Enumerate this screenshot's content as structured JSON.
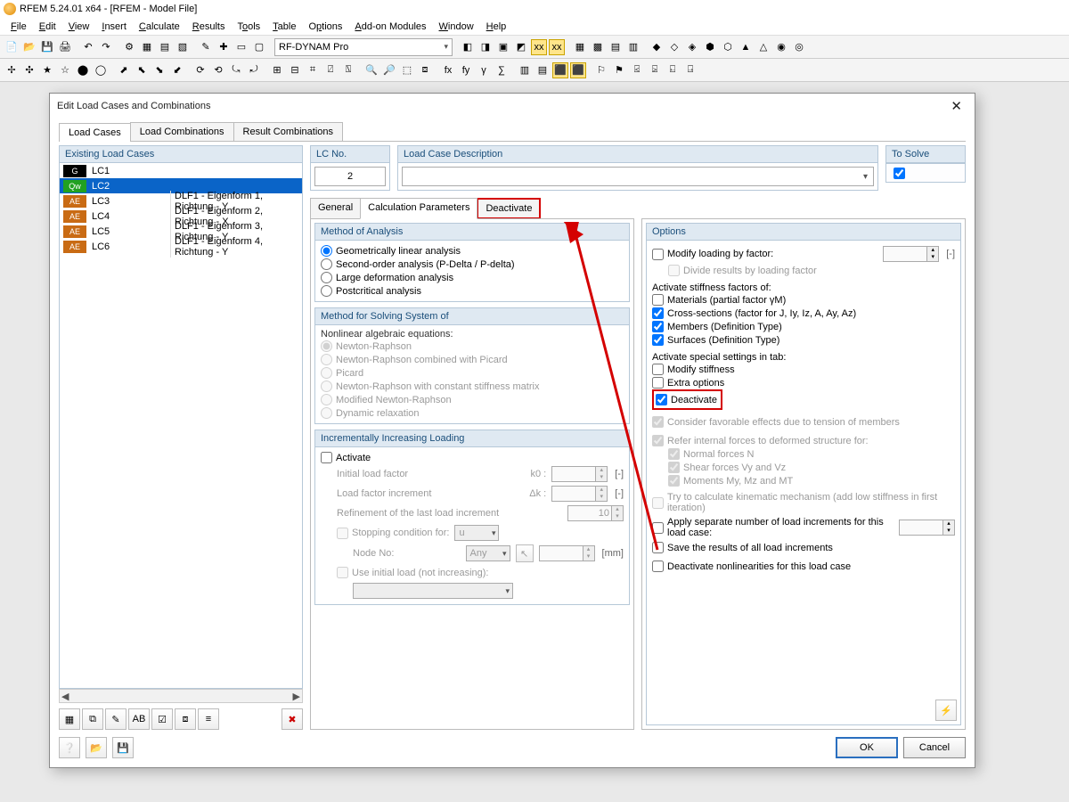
{
  "window": {
    "title": "RFEM 5.24.01 x64 - [RFEM - Model File]"
  },
  "menu": [
    "File",
    "Edit",
    "View",
    "Insert",
    "Calculate",
    "Results",
    "Tools",
    "Table",
    "Options",
    "Add-on Modules",
    "Window",
    "Help"
  ],
  "combo_addon": "RF-DYNAM Pro",
  "dialog": {
    "title": "Edit Load Cases and Combinations",
    "tabs": [
      "Load Cases",
      "Load Combinations",
      "Result Combinations"
    ],
    "activeTab": 0,
    "left": {
      "head": "Existing Load Cases",
      "items": [
        {
          "tag": "G",
          "cls": "g",
          "id": "LC1",
          "desc": ""
        },
        {
          "tag": "Qw",
          "cls": "qw",
          "id": "LC2",
          "desc": "",
          "sel": true
        },
        {
          "tag": "AE",
          "cls": "ae",
          "id": "LC3",
          "desc": "DLF1 - Eigenform 1, Richtung - Y"
        },
        {
          "tag": "AE",
          "cls": "ae",
          "id": "LC4",
          "desc": "DLF1 - Eigenform 2, Richtung - X"
        },
        {
          "tag": "AE",
          "cls": "ae",
          "id": "LC5",
          "desc": "DLF1 - Eigenform 3, Richtung - Y"
        },
        {
          "tag": "AE",
          "cls": "ae",
          "id": "LC6",
          "desc": "DLF1 - Eigenform 4, Richtung - Y"
        }
      ]
    },
    "top": {
      "lcno_label": "LC No.",
      "lcno_value": "2",
      "desc_label": "Load Case Description",
      "desc_value": "",
      "solve_label": "To Solve",
      "solve_checked": true
    },
    "subtabs": [
      "General",
      "Calculation Parameters",
      "Deactivate"
    ],
    "activeSub": 1,
    "method_analysis": {
      "head": "Method of Analysis",
      "opts": [
        "Geometrically linear analysis",
        "Second-order analysis (P-Delta / P-delta)",
        "Large deformation analysis",
        "Postcritical analysis"
      ],
      "selected": 0
    },
    "method_solve": {
      "head": "Method for Solving System of",
      "sub": "Nonlinear algebraic equations:",
      "opts": [
        "Newton-Raphson",
        "Newton-Raphson combined with Picard",
        "Picard",
        "Newton-Raphson with constant stiffness matrix",
        "Modified Newton-Raphson",
        "Dynamic relaxation"
      ]
    },
    "incr": {
      "head": "Incrementally Increasing Loading",
      "activate": "Activate",
      "rows": {
        "initial": "Initial load factor",
        "increment": "Load factor increment",
        "refine": "Refinement of the last load increment",
        "stop": "Stopping condition for:",
        "node": "Node No:",
        "useinit": "Use initial load (not increasing):"
      },
      "k0": "k0 :",
      "dk": "Δk :",
      "ref_val": "10",
      "u": "u",
      "any": "Any",
      "mm": "[mm]",
      "bracket_dash": "[-]"
    },
    "options": {
      "head": "Options",
      "modify_loading": "Modify loading by factor:",
      "divide_results": "Divide results by loading factor",
      "stiff_head": "Activate stiffness factors of:",
      "stiff": {
        "materials": "Materials (partial factor γM)",
        "cross": "Cross-sections (factor for J, Iy, Iz, A, Ay, Az)",
        "members": "Members (Definition Type)",
        "surfaces": "Surfaces (Definition Type)"
      },
      "special_head": "Activate special settings in tab:",
      "special": {
        "modify_stiff": "Modify stiffness",
        "extra": "Extra options",
        "deactivate": "Deactivate"
      },
      "consider": "Consider favorable effects due to tension of members",
      "refer": "Refer internal forces to deformed structure for:",
      "refer_sub": {
        "n": "Normal forces N",
        "v": "Shear forces Vy and Vz",
        "m": "Moments My, Mz and MT"
      },
      "kinematic": "Try to calculate kinematic mechanism (add low stiffness in first iteration)",
      "separate": "Apply separate number of load increments for this load case:",
      "save": "Save the results of all load increments",
      "deact_nl": "Deactivate nonlinearities for this load case"
    },
    "buttons": {
      "ok": "OK",
      "cancel": "Cancel"
    }
  }
}
